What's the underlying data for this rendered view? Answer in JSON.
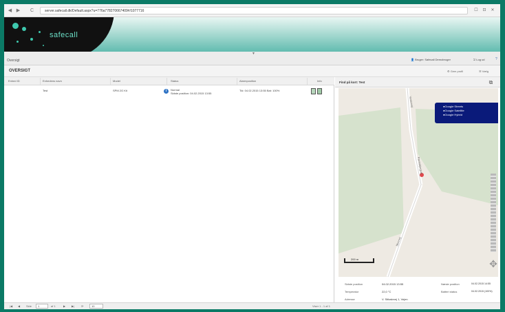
{
  "browser": {
    "back": "◀",
    "forward": "▶",
    "reload": "C",
    "url": "server.safecall.dk/Default.aspx?u=776a778270667409#/1077716",
    "window_controls": [
      "☐",
      "⊡",
      "✕"
    ]
  },
  "banner": {
    "logo_text": "safecall"
  },
  "menu": {
    "toggle": "▼",
    "label": "Oversigt",
    "user": "Bruger: Safecall Demobruger",
    "logout": "Log ud",
    "help": "?"
  },
  "page": {
    "title": "OVERSIGT",
    "buttons": [
      "Gem profil",
      "Vælg"
    ]
  },
  "grid": {
    "columns": [
      "Enhed ID",
      "Enhedens navn",
      "Model",
      "Status",
      "Alarmposition",
      "Info"
    ],
    "rows": [
      {
        "id": "",
        "name": "Test",
        "model": "SPM 2G Kit",
        "status_icon": "i",
        "status_line1": "Normal",
        "status_line2": "Sidste position: 04.02.2015 13:55",
        "alarm": "Tid: 04.02.2015 13:55 Bat: 100%"
      }
    ]
  },
  "pager": {
    "first": "|◀",
    "prev": "◀",
    "page_label": "Side",
    "page_value": "1",
    "of_label": "af 1",
    "next": "▶",
    "last": "▶|",
    "refresh": "⟳",
    "page_size": "10",
    "summary": "Viser 1 - 1 af 1"
  },
  "map": {
    "title": "Find på kort: Test",
    "popout_icon": "external-window-icon",
    "types": [
      "Google Streets",
      "Google Satellite",
      "Google Hybrid"
    ],
    "scale": "200 m",
    "road_label_1": "Vestervej",
    "road_label_2": "Ravnsbjergvej",
    "road_label_3": "Skovvej",
    "marker_color": "#e0474c"
  },
  "info": {
    "rows": [
      {
        "label": "Sidste position",
        "value": "04.02.2015 13:55",
        "label2": "Næste position",
        "value2": "04.02.2015 14:55"
      },
      {
        "label": "Temperatur",
        "value": "22,0 °C",
        "label2": "Batteri status",
        "value2": "04.02.2015 (100%)"
      },
      {
        "label": "Adresse",
        "value": "V. Stibakrvej 1, Vejen",
        "label2": "",
        "value2": ""
      }
    ]
  }
}
